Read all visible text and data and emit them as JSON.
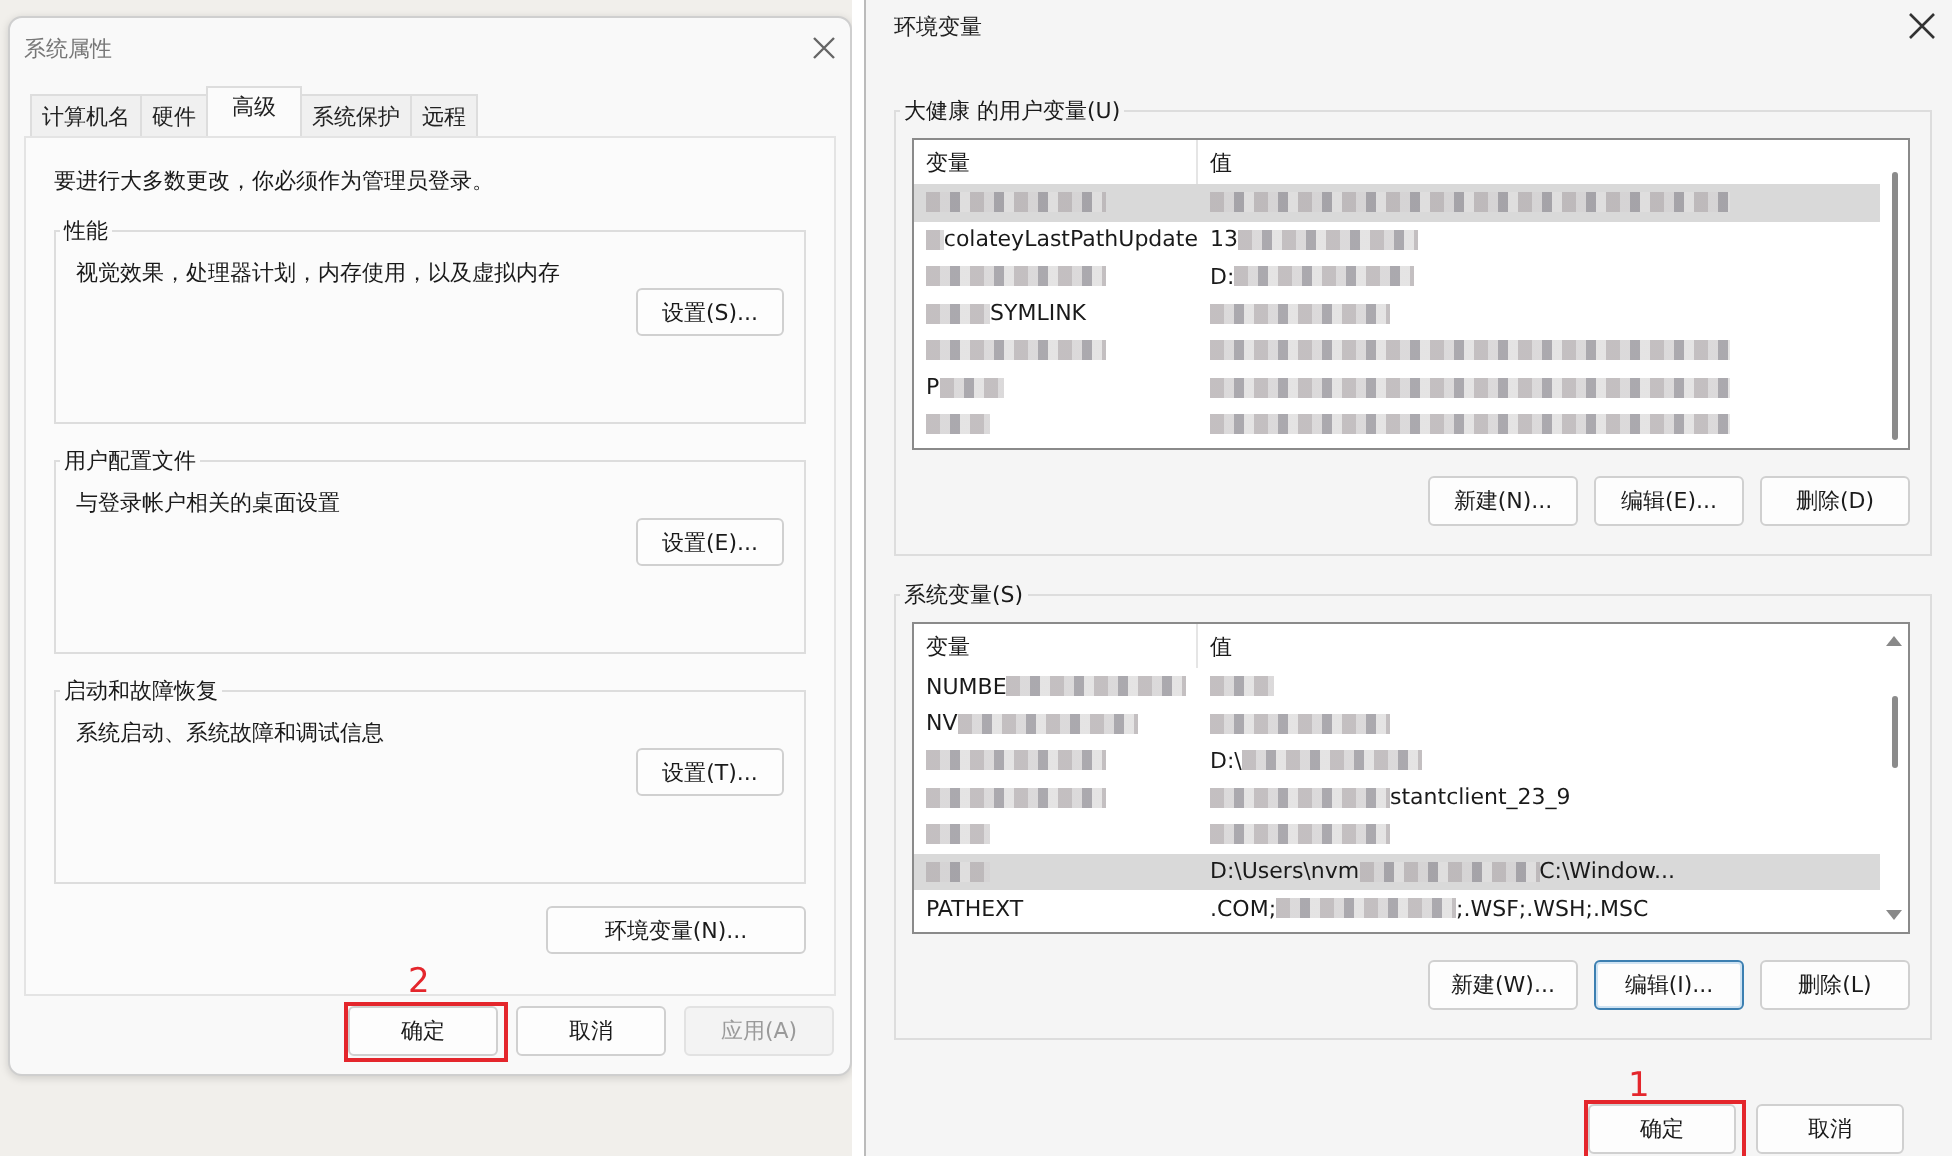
{
  "system_properties": {
    "title": "系统属性",
    "tabs": [
      {
        "label": "计算机名",
        "selected": false
      },
      {
        "label": "硬件",
        "selected": false
      },
      {
        "label": "高级",
        "selected": true
      },
      {
        "label": "系统保护",
        "selected": false
      },
      {
        "label": "远程",
        "selected": false
      }
    ],
    "notice": "要进行大多数更改，你必须作为管理员登录。",
    "groups": [
      {
        "title": "性能",
        "description": "视觉效果，处理器计划，内存使用，以及虚拟内存",
        "button": "设置(S)..."
      },
      {
        "title": "用户配置文件",
        "description": "与登录帐户相关的桌面设置",
        "button": "设置(E)..."
      },
      {
        "title": "启动和故障恢复",
        "description": "系统启动、系统故障和调试信息",
        "button": "设置(T)..."
      }
    ],
    "env_button": "环境变量(N)...",
    "buttons": [
      {
        "label": "确定",
        "disabled": false,
        "annotation": "2"
      },
      {
        "label": "取消",
        "disabled": false
      },
      {
        "label": "应用(A)",
        "disabled": true
      }
    ]
  },
  "environment_variables": {
    "title": "环境变量",
    "user_vars": {
      "title": "大健康 的用户变量(U)",
      "columns": [
        "变量",
        "值"
      ],
      "rows": [
        {
          "selected": true,
          "name": [
            {
              "kind": "blur-long"
            }
          ],
          "value": [
            {
              "kind": "blur-full"
            }
          ]
        },
        {
          "selected": false,
          "name": [
            {
              "kind": "blur"
            },
            {
              "kind": "text",
              "text": "colateyLastPathUpdate"
            }
          ],
          "value": [
            {
              "kind": "text",
              "text": "13"
            },
            {
              "kind": "blur-long"
            }
          ]
        },
        {
          "selected": false,
          "name": [
            {
              "kind": "blur-long"
            }
          ],
          "value": [
            {
              "kind": "text",
              "text": "D:"
            },
            {
              "kind": "blur-long"
            }
          ]
        },
        {
          "selected": false,
          "name": [
            {
              "kind": "blur"
            },
            {
              "kind": "text",
              "text": "SYMLINK"
            }
          ],
          "value": [
            {
              "kind": "blur-long"
            }
          ]
        },
        {
          "selected": false,
          "name": [
            {
              "kind": "blur-long"
            }
          ],
          "value": [
            {
              "kind": "blur-full"
            }
          ]
        },
        {
          "selected": false,
          "name": [
            {
              "kind": "text",
              "text": "P"
            },
            {
              "kind": "blur"
            }
          ],
          "value": [
            {
              "kind": "blur-full"
            }
          ]
        },
        {
          "selected": false,
          "name": [
            {
              "kind": "blur"
            }
          ],
          "value": [
            {
              "kind": "blur-full"
            }
          ]
        }
      ],
      "buttons": [
        {
          "label": "新建(N)...",
          "focused": false
        },
        {
          "label": "编辑(E)...",
          "focused": false
        },
        {
          "label": "删除(D)",
          "focused": false
        }
      ]
    },
    "system_vars": {
      "title": "系统变量(S)",
      "columns": [
        "变量",
        "值"
      ],
      "rows": [
        {
          "selected": false,
          "name": [
            {
              "kind": "text",
              "text": "NUMBE"
            },
            {
              "kind": "blur-long"
            }
          ],
          "value": [
            {
              "kind": "blur"
            }
          ]
        },
        {
          "selected": false,
          "name": [
            {
              "kind": "text",
              "text": "NV"
            },
            {
              "kind": "blur-long"
            }
          ],
          "value": [
            {
              "kind": "blur-long"
            }
          ]
        },
        {
          "selected": false,
          "name": [
            {
              "kind": "blur-long"
            }
          ],
          "value": [
            {
              "kind": "text",
              "text": "D:\\"
            },
            {
              "kind": "blur-long"
            }
          ]
        },
        {
          "selected": false,
          "name": [
            {
              "kind": "blur-long"
            }
          ],
          "value": [
            {
              "kind": "blur-long"
            },
            {
              "kind": "text",
              "text": "stantclient_23_9"
            }
          ]
        },
        {
          "selected": false,
          "name": [
            {
              "kind": "blur"
            }
          ],
          "value": [
            {
              "kind": "blur-long"
            }
          ]
        },
        {
          "selected": true,
          "name": [
            {
              "kind": "blur"
            }
          ],
          "value": [
            {
              "kind": "text",
              "text": "D:\\Users\\nvm"
            },
            {
              "kind": "blur-long"
            },
            {
              "kind": "text",
              "text": "C:\\Window..."
            }
          ]
        },
        {
          "selected": false,
          "name": [
            {
              "kind": "text",
              "text": "PATHEXT"
            }
          ],
          "value": [
            {
              "kind": "text",
              "text": ".COM;"
            },
            {
              "kind": "blur-long"
            },
            {
              "kind": "text",
              "text": ";.WSF;.WSH;.MSC"
            }
          ]
        }
      ],
      "buttons": [
        {
          "label": "新建(W)...",
          "focused": false
        },
        {
          "label": "编辑(I)...",
          "focused": true
        },
        {
          "label": "删除(L)",
          "focused": false
        }
      ]
    },
    "buttons": [
      {
        "label": "确定",
        "annotation": "1"
      },
      {
        "label": "取消"
      }
    ]
  }
}
